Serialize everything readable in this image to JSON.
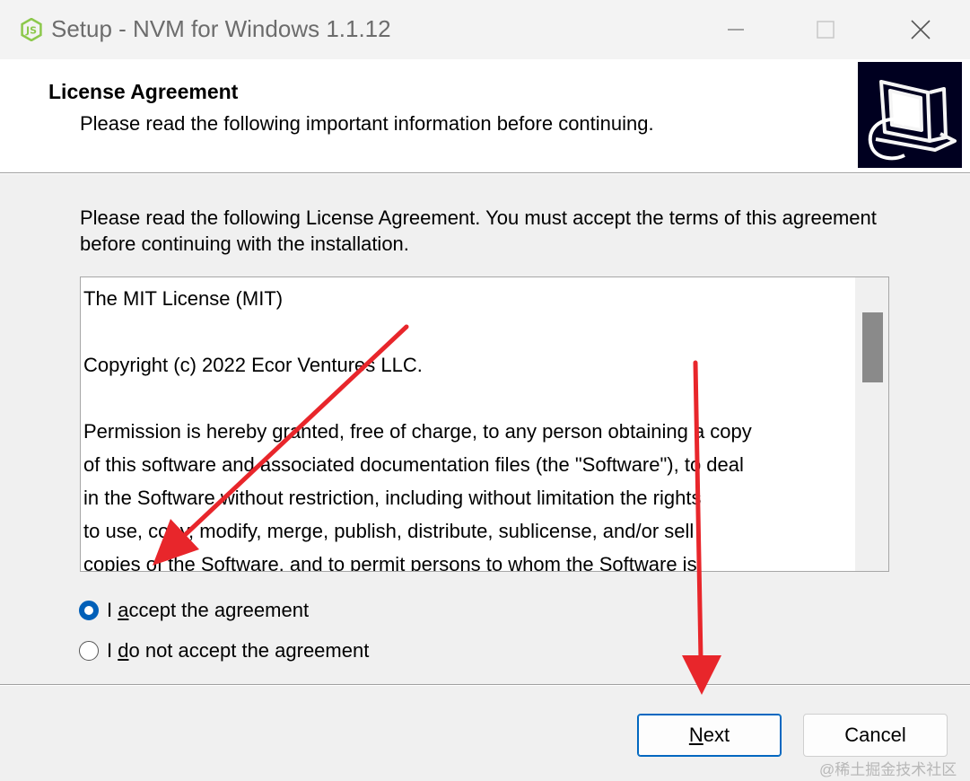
{
  "window": {
    "title": "Setup - NVM for Windows 1.1.12"
  },
  "header": {
    "title": "License Agreement",
    "subtitle": "Please read the following important information before continuing."
  },
  "intro": "Please read the following License Agreement. You must accept the terms of this agreement before continuing with the installation.",
  "license": {
    "lines": [
      "The MIT License (MIT)",
      "",
      "Copyright (c) 2022 Ecor Ventures LLC.",
      "",
      "Permission is hereby granted, free of charge, to any person obtaining a copy",
      "of this software and associated documentation files (the \"Software\"), to deal",
      "in the Software without restriction, including without limitation the rights",
      "to use, copy, modify, merge, publish, distribute, sublicense, and/or sell",
      "copies of the Software, and to permit persons to whom the Software is"
    ]
  },
  "options": {
    "accept": {
      "prefix": "I ",
      "mnemonic": "a",
      "rest": "ccept the agreement",
      "selected": true
    },
    "decline": {
      "prefix": "I ",
      "mnemonic": "d",
      "rest": "o not accept the agreement",
      "selected": false
    }
  },
  "buttons": {
    "next": {
      "mnemonic": "N",
      "rest": "ext"
    },
    "cancel": "Cancel"
  },
  "watermark": "@稀土掘金技术社区",
  "colors": {
    "accent": "#005fb8",
    "annotation_arrow": "#e8262b"
  },
  "icons": {
    "app": "nodejs-icon",
    "header": "installer-computer-icon"
  }
}
